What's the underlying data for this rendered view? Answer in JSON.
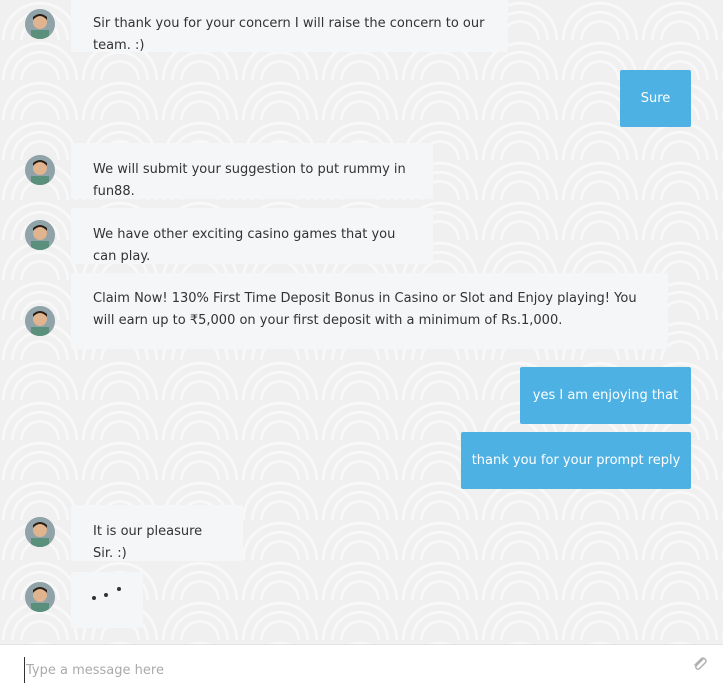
{
  "messages": [
    {
      "sender": "bot",
      "text": "Sir thank you for your concern I will raise the concern to our team. :)"
    },
    {
      "sender": "user",
      "text": "Sure"
    },
    {
      "sender": "bot",
      "text": "We will submit your suggestion to put rummy in fun88."
    },
    {
      "sender": "bot",
      "text": "We have other exciting casino games that you can play."
    },
    {
      "sender": "bot",
      "text": "Claim Now! 130% First Time Deposit Bonus in Casino or Slot and Enjoy playing! You will earn up to ₹5,000 on your first deposit with a minimum of Rs.1,000."
    },
    {
      "sender": "user",
      "text": "yes I am enjoying that"
    },
    {
      "sender": "user",
      "text": "thank you for your prompt reply"
    },
    {
      "sender": "bot",
      "text": "It is our pleasure Sir. :)"
    }
  ],
  "typing_indicator": {
    "sender": "bot",
    "icon": "typing-dots-icon"
  },
  "composer": {
    "placeholder": "Type a message here",
    "value": "",
    "attach_icon": "paperclip-icon"
  },
  "colors": {
    "user_bubble": "#4db1e3",
    "bot_bubble": "#f4f6f8",
    "background": "#f0f0f0"
  }
}
